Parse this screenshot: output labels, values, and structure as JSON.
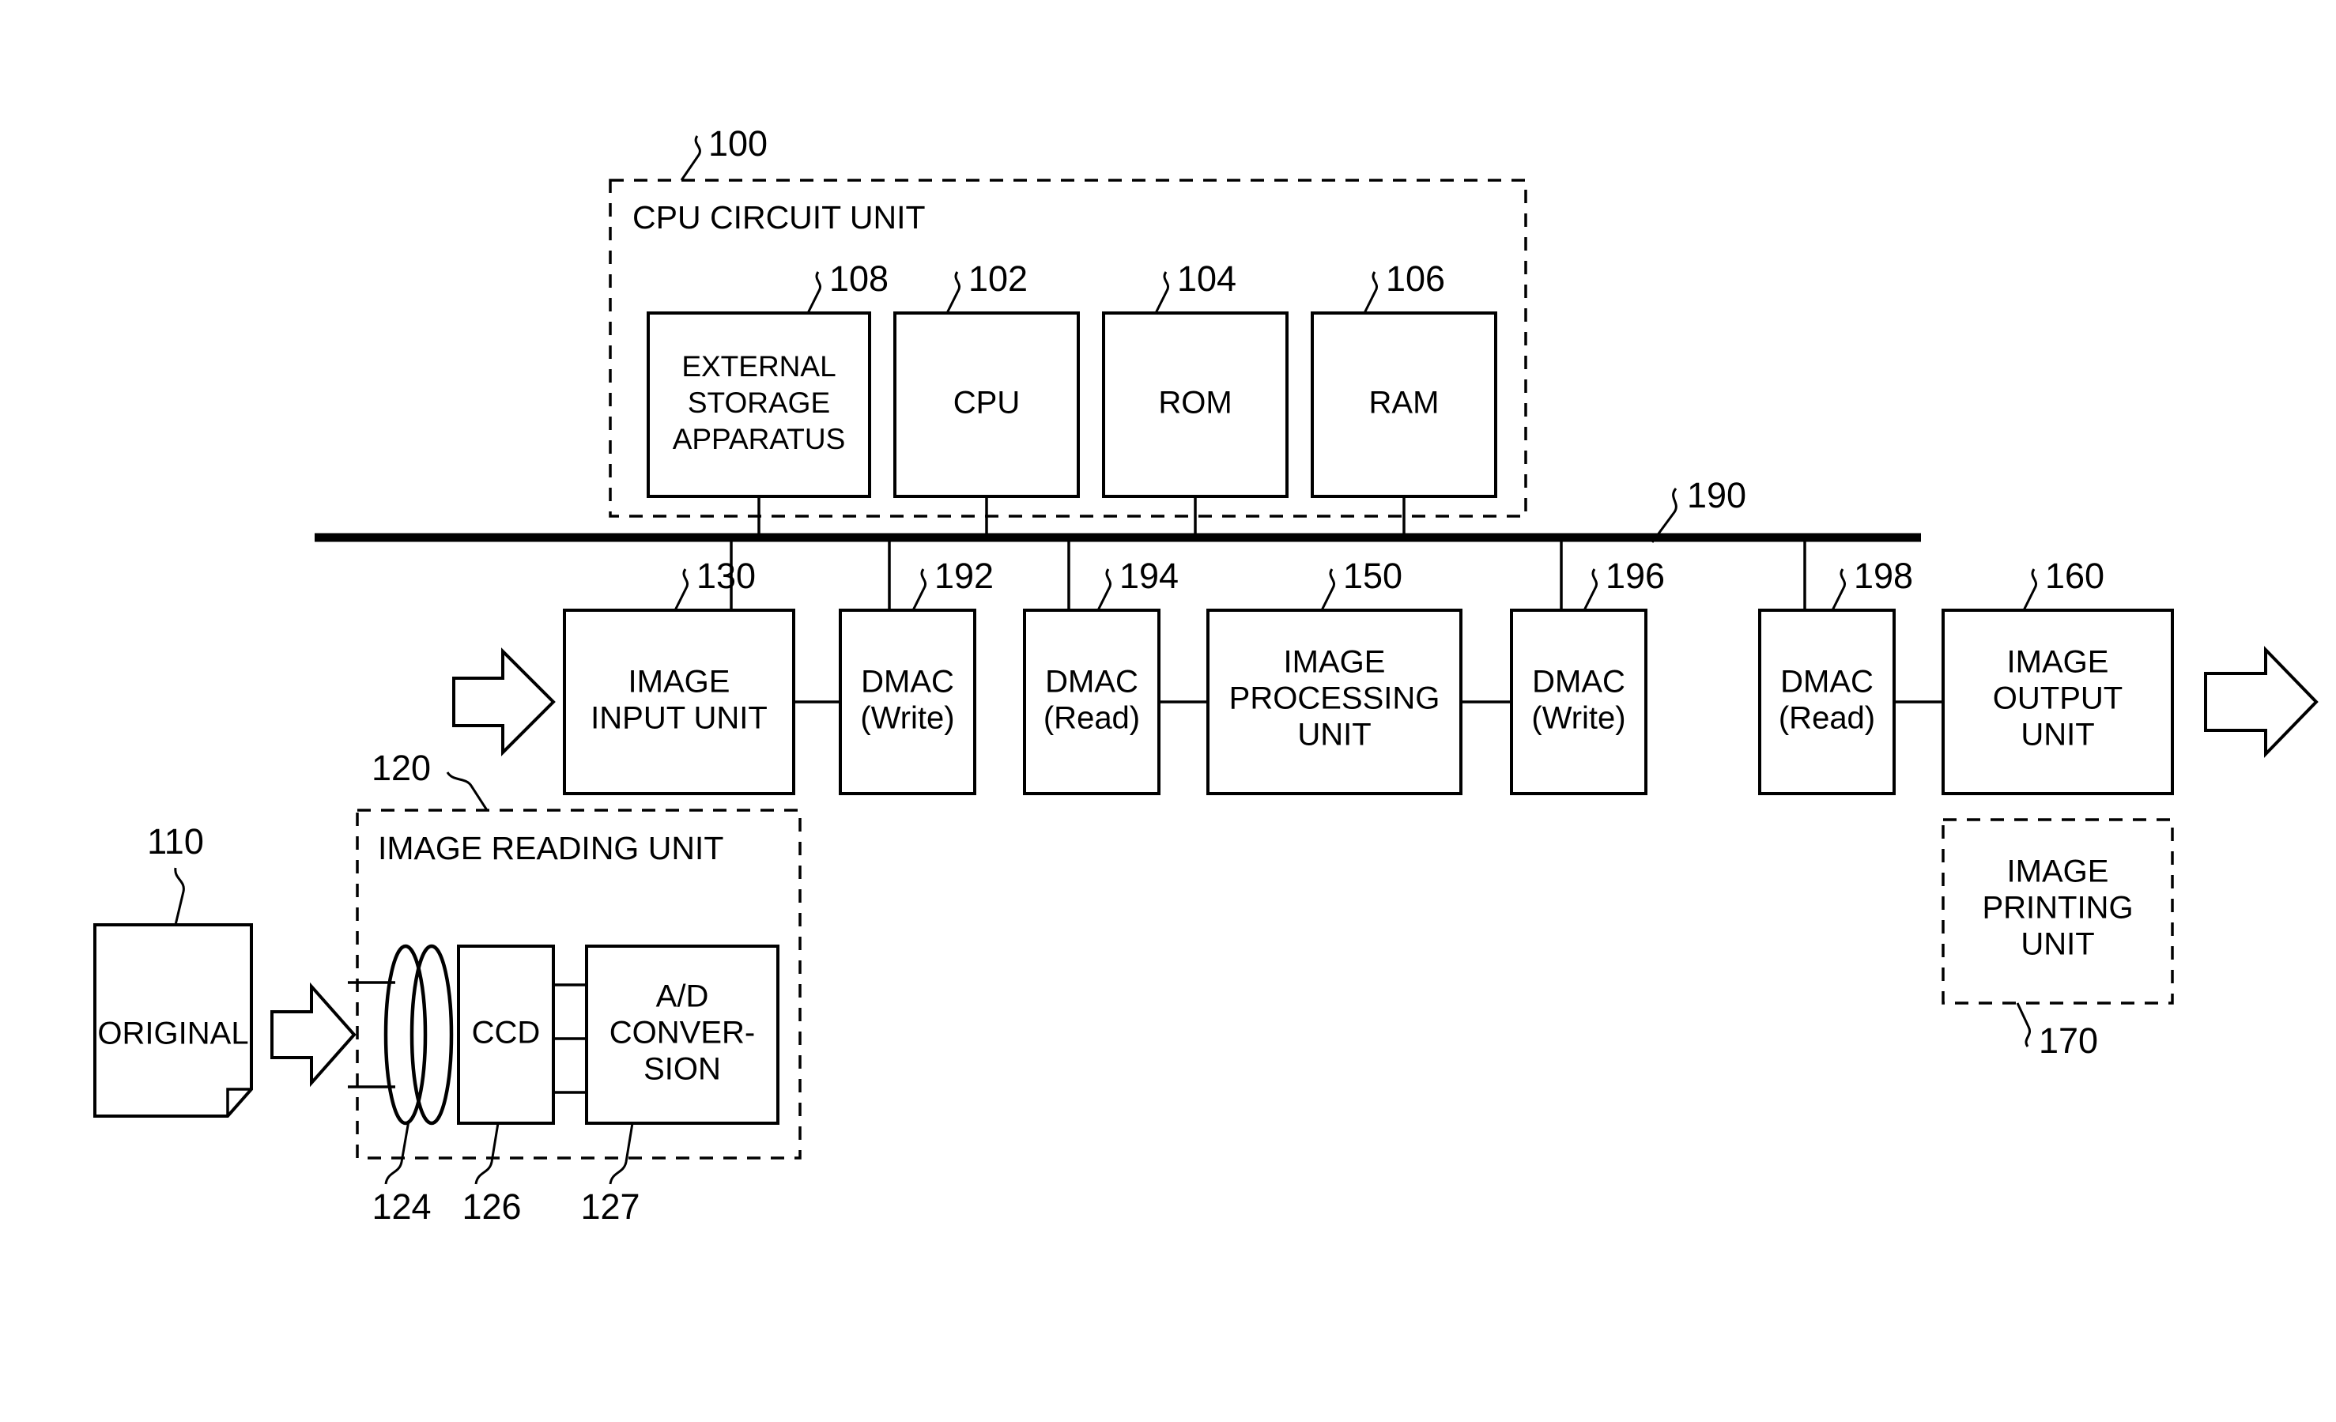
{
  "figure": {
    "title": "Image processing apparatus block diagram",
    "line_color": "#000000",
    "background": "#ffffff"
  },
  "cpu_circuit_unit": {
    "group_label": "CPU CIRCUIT UNIT",
    "ref": "100",
    "blocks": [
      {
        "label_lines": [
          "EXTERNAL",
          "STORAGE",
          "APPARATUS"
        ],
        "ref": "108"
      },
      {
        "label_lines": [
          "CPU"
        ],
        "ref": "102"
      },
      {
        "label_lines": [
          "ROM"
        ],
        "ref": "104"
      },
      {
        "label_lines": [
          "RAM"
        ],
        "ref": "106"
      }
    ]
  },
  "bus": {
    "ref": "190"
  },
  "pipeline": {
    "blocks": [
      {
        "label_lines": [
          "IMAGE",
          "INPUT UNIT"
        ],
        "ref": "130"
      },
      {
        "label_lines": [
          "DMAC",
          "(Write)"
        ],
        "ref": "192"
      },
      {
        "label_lines": [
          "DMAC",
          "(Read)"
        ],
        "ref": "194"
      },
      {
        "label_lines": [
          "IMAGE",
          "PROCESSING",
          "UNIT"
        ],
        "ref": "150"
      },
      {
        "label_lines": [
          "DMAC",
          "(Write)"
        ],
        "ref": "196"
      },
      {
        "label_lines": [
          "DMAC",
          "(Read)"
        ],
        "ref": "198"
      },
      {
        "label_lines": [
          "IMAGE",
          "OUTPUT",
          "UNIT"
        ],
        "ref": "160"
      }
    ]
  },
  "image_printing_unit": {
    "label_lines": [
      "IMAGE",
      "PRINTING",
      "UNIT"
    ],
    "ref": "170"
  },
  "image_reading_unit": {
    "group_label": "IMAGE READING UNIT",
    "ref": "120",
    "lens": {
      "ref": "124"
    },
    "blocks": [
      {
        "label_lines": [
          "CCD"
        ],
        "ref": "126"
      },
      {
        "label_lines": [
          "A/D",
          "CONVER-",
          "SION"
        ],
        "ref": "127"
      }
    ]
  },
  "original": {
    "label": "ORIGINAL",
    "ref": "110"
  },
  "arrows": {
    "original_to_reader": "block-arrow-right",
    "reader_to_input": "block-arrow-right",
    "output_exit": "block-arrow-right"
  }
}
